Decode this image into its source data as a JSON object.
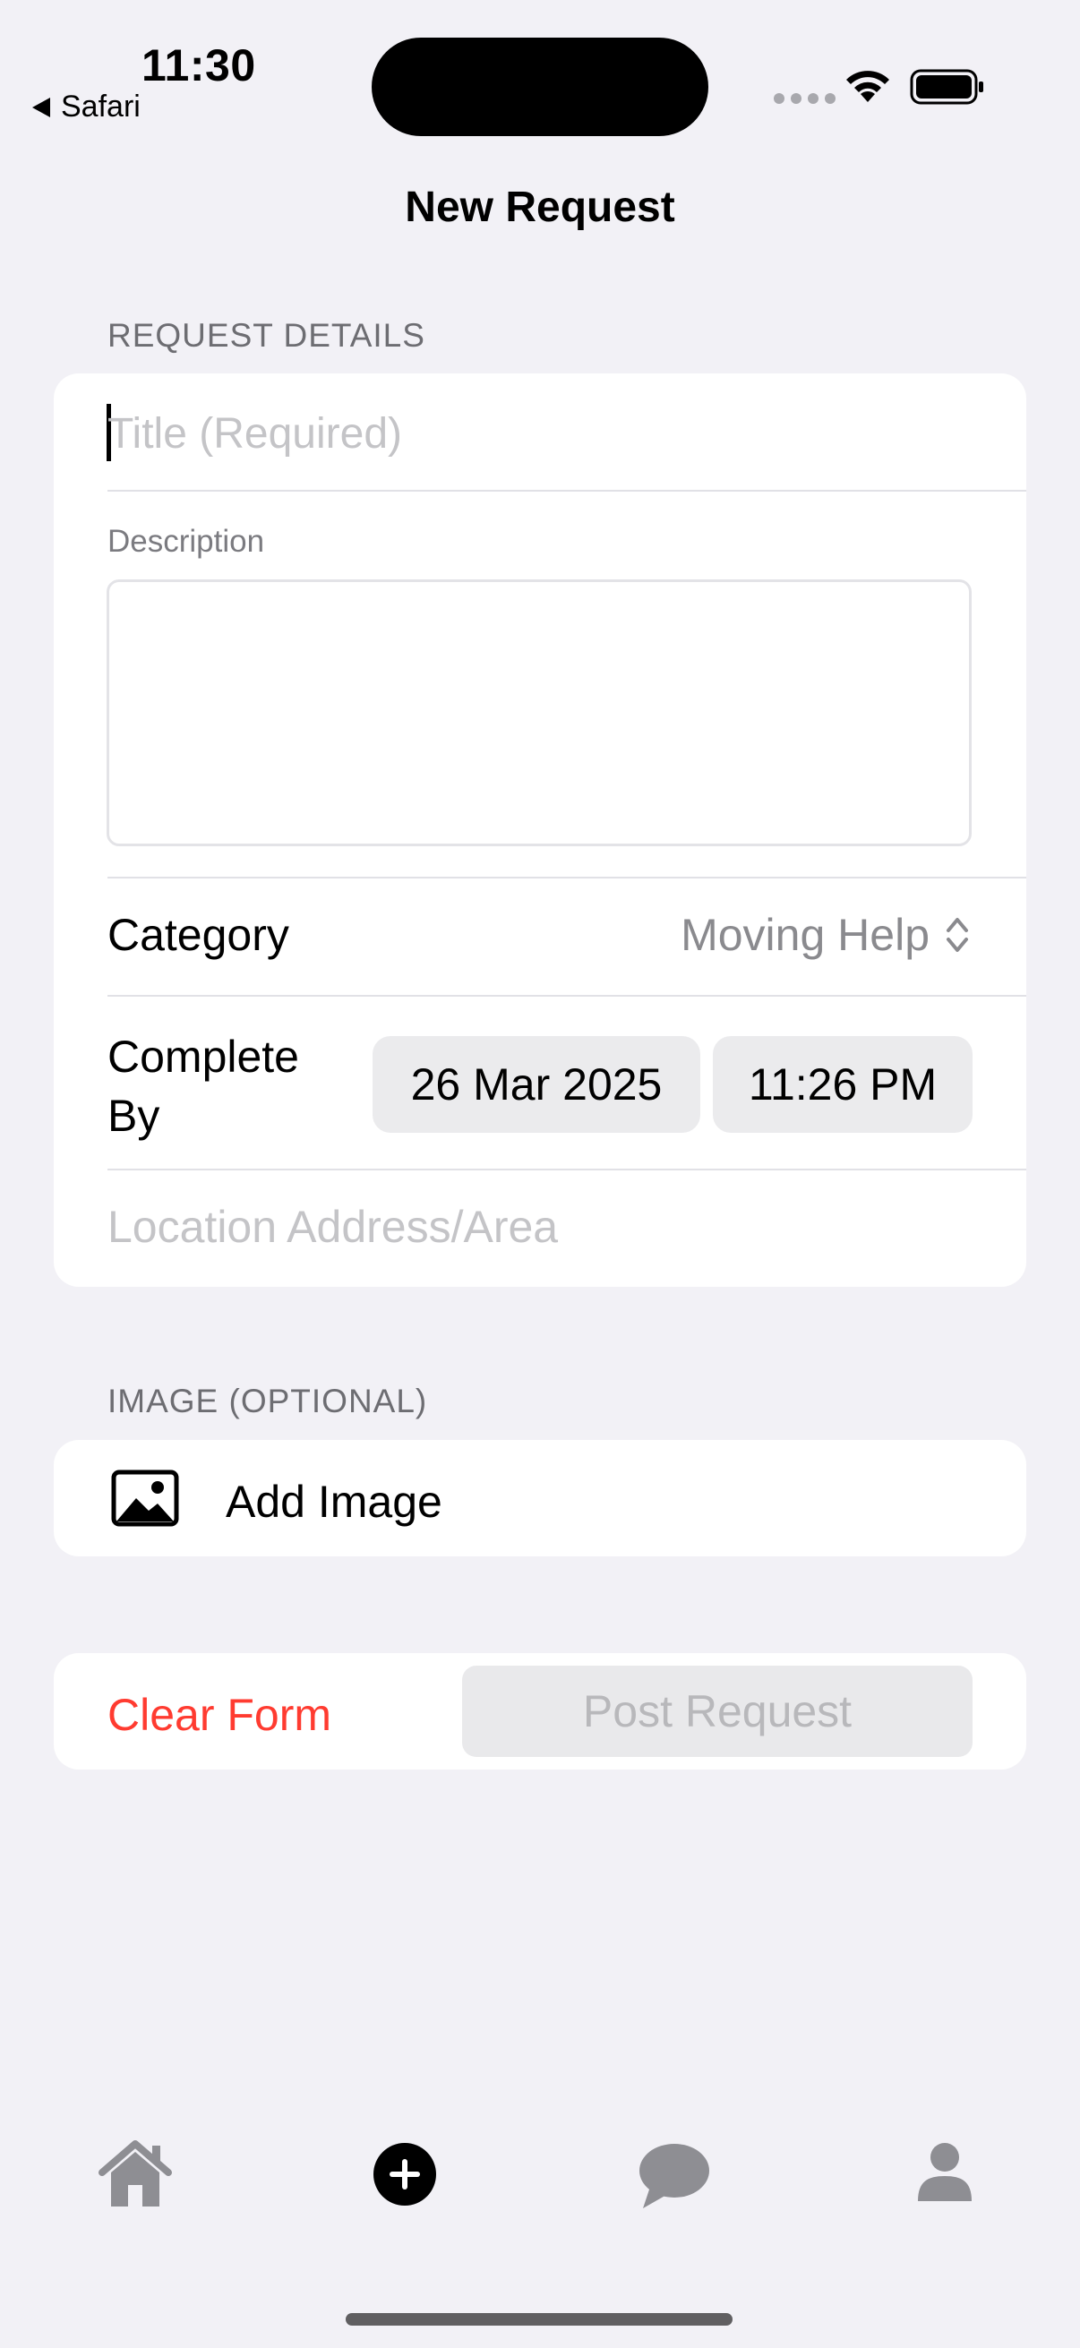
{
  "status_bar": {
    "time": "11:30",
    "back_app": "Safari"
  },
  "nav": {
    "title": "New Request"
  },
  "request_details": {
    "header": "REQUEST DETAILS",
    "title_placeholder": "Title (Required)",
    "description_label": "Description",
    "description_value": "",
    "category_label": "Category",
    "category_value": "Moving Help",
    "complete_by_label_line1": "Complete",
    "complete_by_label_line2": "By",
    "date_value": "26 Mar 2025",
    "time_value": "11:26 PM",
    "location_placeholder": "Location Address/Area"
  },
  "image_section": {
    "header": "IMAGE (OPTIONAL)",
    "add_image_label": "Add Image"
  },
  "actions": {
    "clear_label": "Clear Form",
    "post_label": "Post Request"
  },
  "tab_bar": {
    "items": [
      "home-icon",
      "add-circle-icon",
      "chat-bubble-icon",
      "person-icon"
    ]
  },
  "colors": {
    "background": "#f2f1f6",
    "destructive": "#ff3b30",
    "secondary_text": "#8a8a8e",
    "disabled_text": "#b8b8bb",
    "tab_inactive": "#8e8e93"
  }
}
